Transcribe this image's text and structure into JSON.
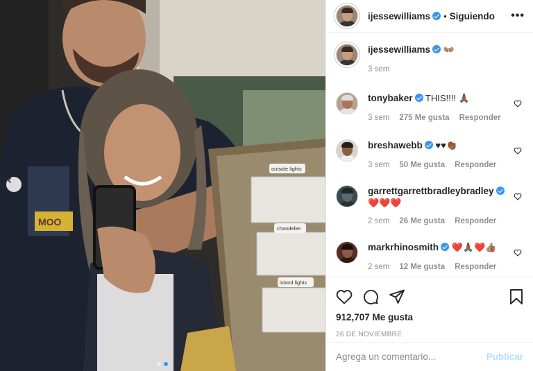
{
  "colors": {
    "accent": "#3897f0",
    "muted": "#8e8e8e",
    "heart": "#ed4956",
    "publish_disabled": "#b2dffc"
  },
  "photo": {
    "carousel_prev_icon": "chevron-left-icon",
    "signs": [
      "outside lights",
      "chandelier",
      "island lights"
    ],
    "tshirt_text": "MOO"
  },
  "header": {
    "username": "ijessewilliams",
    "separator": "•",
    "following_label": "Siguiendo",
    "more_icon": "more-options-icon"
  },
  "caption": {
    "username": "ijessewilliams",
    "text": "👐🏽",
    "time": "3 sem"
  },
  "comments": [
    {
      "username": "tonybaker",
      "text": "THIS!!!! 🙏🏾",
      "time": "3 sem",
      "likes": "275 Me gusta",
      "reply": "Responder"
    },
    {
      "username": "breshawebb",
      "text": "♥♥👏🏾",
      "time": "3 sem",
      "likes": "50 Me gusta",
      "reply": "Responder"
    },
    {
      "username": "garrettgarrettbradleybradley",
      "text": "❤️❤️❤️",
      "time": "2 sem",
      "likes": "26 Me gusta",
      "reply": "Responder"
    },
    {
      "username": "markrhinosmith",
      "text": "❤️🙏🏾❤️👍🏽",
      "time": "2 sem",
      "likes": "12 Me gusta",
      "reply": "Responder"
    }
  ],
  "actions": {
    "like_icon": "heart-icon",
    "comment_icon": "comment-icon",
    "share_icon": "share-icon",
    "save_icon": "bookmark-icon",
    "likes_count": "912,707 Me gusta",
    "date": "26 DE NOVIEMBRE"
  },
  "add_comment": {
    "placeholder": "Agrega un comentario...",
    "publish_label": "Publicar"
  }
}
